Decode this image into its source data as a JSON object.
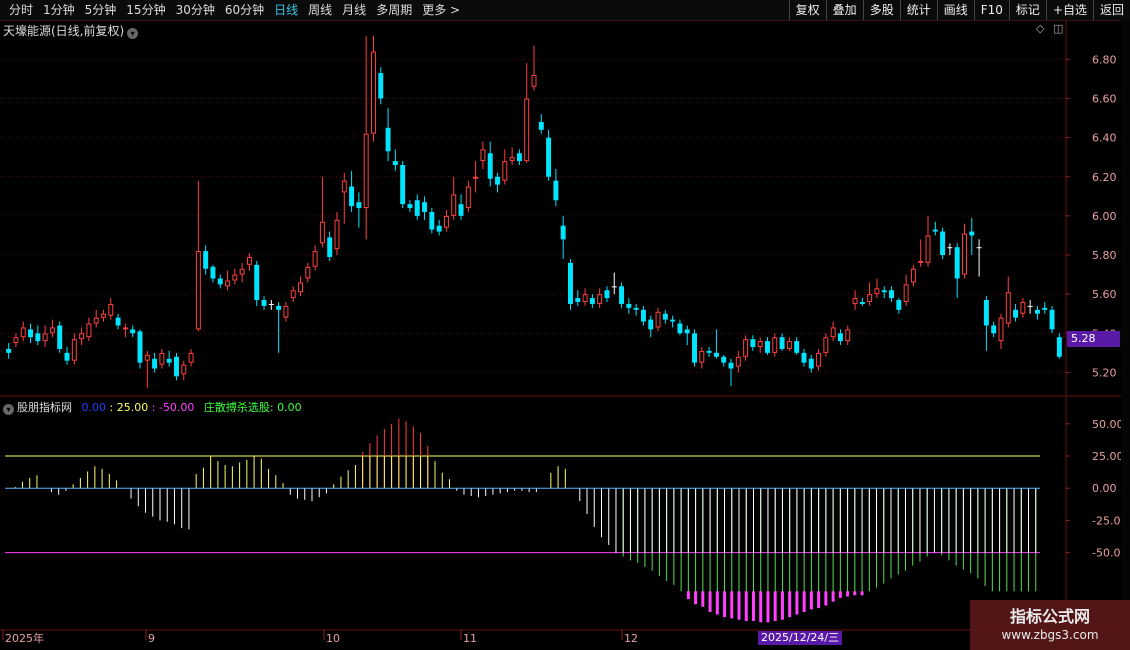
{
  "toolbar": {
    "periods": [
      "分时",
      "1分钟",
      "5分钟",
      "15分钟",
      "30分钟",
      "60分钟",
      "日线",
      "周线",
      "月线",
      "多周期",
      "更多 >"
    ],
    "active_period": "日线",
    "actions": [
      "复权",
      "叠加",
      "多股",
      "统计",
      "画线",
      "F10",
      "标记",
      "+自选",
      "返回"
    ]
  },
  "chart": {
    "title": "天壕能源(日线,前复权)",
    "price_ticks": [
      "6.80",
      "6.60",
      "6.40",
      "6.20",
      "6.00",
      "5.80",
      "5.60",
      "5.40",
      "5.20"
    ],
    "price_ticks_values": [
      6.8,
      6.6,
      6.4,
      6.2,
      6.0,
      5.8,
      5.6,
      5.4,
      5.2
    ],
    "current_price": "5.28",
    "colors": {
      "up": "#ff4040",
      "down": "#00e5ff",
      "flat": "#ffffff"
    }
  },
  "indicator": {
    "name": "股朋指标网",
    "line0": "0.00",
    "line25": "25.00",
    "line_neg50": "-50.00",
    "select_label": "庄散搏杀选股: 0.00",
    "axis_ticks": [
      "50.00",
      "25.00",
      "0.00",
      "-25.00",
      "-50.00"
    ],
    "axis_values": [
      50,
      25,
      0,
      -25,
      -50
    ]
  },
  "xaxis": {
    "labels": [
      "2025年",
      "9",
      "10",
      "11",
      "12"
    ],
    "cursor_date": "2025/12/24/三"
  },
  "watermark": {
    "line1": "指标公式网",
    "line2": "www.zbgs3.com"
  },
  "icons": [
    "chevron-down-icon",
    "diamond-icon",
    "window-restore-icon"
  ],
  "chart_data": {
    "type": "candlestick",
    "title": "天壕能源(日线,前复权)",
    "ylim": [
      5.1,
      6.95
    ],
    "candles": [
      [
        5.32,
        5.3,
        5.35,
        5.27
      ],
      [
        5.35,
        5.38,
        5.4,
        5.33
      ],
      [
        5.38,
        5.43,
        5.46,
        5.36
      ],
      [
        5.42,
        5.38,
        5.45,
        5.35
      ],
      [
        5.4,
        5.36,
        5.44,
        5.34
      ],
      [
        5.36,
        5.4,
        5.44,
        5.33
      ],
      [
        5.4,
        5.43,
        5.47,
        5.38
      ],
      [
        5.44,
        5.32,
        5.46,
        5.3
      ],
      [
        5.3,
        5.26,
        5.33,
        5.24
      ],
      [
        5.26,
        5.37,
        5.4,
        5.24
      ],
      [
        5.37,
        5.4,
        5.43,
        5.34
      ],
      [
        5.38,
        5.45,
        5.48,
        5.36
      ],
      [
        5.45,
        5.48,
        5.52,
        5.43
      ],
      [
        5.48,
        5.5,
        5.52,
        5.46
      ],
      [
        5.49,
        5.55,
        5.58,
        5.47
      ],
      [
        5.48,
        5.44,
        5.5,
        5.42
      ],
      [
        5.42,
        5.43,
        5.45,
        5.38
      ],
      [
        5.42,
        5.4,
        5.44,
        5.38
      ],
      [
        5.41,
        5.25,
        5.42,
        5.22
      ],
      [
        5.26,
        5.29,
        5.31,
        5.12
      ],
      [
        5.27,
        5.22,
        5.3,
        5.2
      ],
      [
        5.24,
        5.3,
        5.32,
        5.22
      ],
      [
        5.27,
        5.25,
        5.31,
        5.23
      ],
      [
        5.28,
        5.18,
        5.3,
        5.16
      ],
      [
        5.19,
        5.24,
        5.26,
        5.16
      ],
      [
        5.25,
        5.3,
        5.32,
        5.23
      ],
      [
        5.42,
        5.82,
        6.18,
        5.41
      ],
      [
        5.82,
        5.73,
        5.85,
        5.7
      ],
      [
        5.74,
        5.68,
        5.75,
        5.66
      ],
      [
        5.68,
        5.65,
        5.7,
        5.63
      ],
      [
        5.64,
        5.67,
        5.72,
        5.62
      ],
      [
        5.67,
        5.7,
        5.73,
        5.65
      ],
      [
        5.7,
        5.73,
        5.76,
        5.66
      ],
      [
        5.75,
        5.79,
        5.81,
        5.72
      ],
      [
        5.75,
        5.57,
        5.77,
        5.54
      ],
      [
        5.57,
        5.54,
        5.59,
        5.52
      ],
      [
        5.55,
        5.55,
        5.57,
        5.52
      ],
      [
        5.54,
        5.52,
        5.56,
        5.3
      ],
      [
        5.48,
        5.54,
        5.56,
        5.46
      ],
      [
        5.58,
        5.62,
        5.64,
        5.56
      ],
      [
        5.61,
        5.66,
        5.69,
        5.59
      ],
      [
        5.68,
        5.74,
        5.76,
        5.66
      ],
      [
        5.74,
        5.82,
        5.85,
        5.72
      ],
      [
        5.86,
        5.97,
        6.2,
        5.84
      ],
      [
        5.89,
        5.79,
        5.92,
        5.77
      ],
      [
        5.83,
        5.98,
        6.02,
        5.8
      ],
      [
        6.12,
        6.18,
        6.22,
        5.96
      ],
      [
        6.15,
        6.05,
        6.23,
        6.02
      ],
      [
        6.07,
        6.04,
        6.12,
        5.94
      ],
      [
        6.04,
        6.42,
        6.92,
        5.88
      ],
      [
        6.42,
        6.84,
        6.92,
        6.38
      ],
      [
        6.73,
        6.6,
        6.76,
        6.57
      ],
      [
        6.45,
        6.33,
        6.55,
        6.28
      ],
      [
        6.28,
        6.26,
        6.34,
        6.23
      ],
      [
        6.26,
        6.06,
        6.28,
        6.04
      ],
      [
        6.06,
        6.04,
        6.08,
        6.02
      ],
      [
        6.08,
        6.0,
        6.11,
        5.98
      ],
      [
        6.07,
        6.02,
        6.1,
        5.98
      ],
      [
        6.02,
        5.93,
        6.04,
        5.91
      ],
      [
        5.95,
        5.92,
        5.98,
        5.9
      ],
      [
        5.94,
        6.0,
        6.03,
        5.92
      ],
      [
        6.0,
        6.11,
        6.2,
        5.98
      ],
      [
        6.06,
        6.0,
        6.11,
        5.98
      ],
      [
        6.04,
        6.15,
        6.18,
        6.02
      ],
      [
        6.19,
        6.2,
        6.28,
        6.12
      ],
      [
        6.28,
        6.34,
        6.38,
        6.24
      ],
      [
        6.32,
        6.19,
        6.38,
        6.15
      ],
      [
        6.2,
        6.16,
        6.22,
        6.12
      ],
      [
        6.18,
        6.28,
        6.34,
        6.16
      ],
      [
        6.28,
        6.3,
        6.35,
        6.26
      ],
      [
        6.32,
        6.28,
        6.34,
        6.26
      ],
      [
        6.28,
        6.6,
        6.78,
        6.27
      ],
      [
        6.66,
        6.72,
        6.87,
        6.64
      ],
      [
        6.48,
        6.44,
        6.52,
        6.42
      ],
      [
        6.4,
        6.2,
        6.44,
        6.18
      ],
      [
        6.18,
        6.08,
        6.24,
        6.05
      ],
      [
        5.95,
        5.88,
        6.0,
        5.78
      ],
      [
        5.76,
        5.55,
        5.78,
        5.52
      ],
      [
        5.58,
        5.56,
        5.62,
        5.54
      ],
      [
        5.56,
        5.6,
        5.63,
        5.54
      ],
      [
        5.58,
        5.55,
        5.6,
        5.53
      ],
      [
        5.55,
        5.6,
        5.63,
        5.53
      ],
      [
        5.62,
        5.58,
        5.64,
        5.56
      ],
      [
        5.64,
        5.64,
        5.71,
        5.6
      ],
      [
        5.64,
        5.55,
        5.66,
        5.53
      ],
      [
        5.55,
        5.53,
        5.58,
        5.5
      ],
      [
        5.53,
        5.52,
        5.55,
        5.49
      ],
      [
        5.52,
        5.46,
        5.54,
        5.44
      ],
      [
        5.47,
        5.42,
        5.49,
        5.38
      ],
      [
        5.43,
        5.51,
        5.53,
        5.41
      ],
      [
        5.5,
        5.47,
        5.52,
        5.45
      ],
      [
        5.47,
        5.46,
        5.49,
        5.43
      ],
      [
        5.45,
        5.4,
        5.47,
        5.39
      ],
      [
        5.42,
        5.4,
        5.44,
        5.34
      ],
      [
        5.4,
        5.25,
        5.42,
        5.23
      ],
      [
        5.25,
        5.31,
        5.33,
        5.22
      ],
      [
        5.31,
        5.3,
        5.33,
        5.28
      ],
      [
        5.3,
        5.28,
        5.42,
        5.27
      ],
      [
        5.28,
        5.25,
        5.29,
        5.23
      ],
      [
        5.25,
        5.22,
        5.27,
        5.13
      ],
      [
        5.23,
        5.28,
        5.31,
        5.2
      ],
      [
        5.28,
        5.37,
        5.39,
        5.26
      ],
      [
        5.37,
        5.33,
        5.39,
        5.31
      ],
      [
        5.33,
        5.36,
        5.38,
        5.3
      ],
      [
        5.36,
        5.3,
        5.38,
        5.29
      ],
      [
        5.3,
        5.38,
        5.4,
        5.28
      ],
      [
        5.38,
        5.32,
        5.4,
        5.31
      ],
      [
        5.32,
        5.36,
        5.38,
        5.31
      ],
      [
        5.36,
        5.3,
        5.38,
        5.29
      ],
      [
        5.3,
        5.25,
        5.32,
        5.23
      ],
      [
        5.27,
        5.22,
        5.29,
        5.2
      ],
      [
        5.23,
        5.3,
        5.32,
        5.21
      ],
      [
        5.3,
        5.38,
        5.4,
        5.28
      ],
      [
        5.38,
        5.43,
        5.46,
        5.36
      ],
      [
        5.4,
        5.36,
        5.42,
        5.34
      ],
      [
        5.36,
        5.42,
        5.44,
        5.34
      ],
      [
        5.55,
        5.58,
        5.62,
        5.52
      ],
      [
        5.56,
        5.55,
        5.58,
        5.54
      ],
      [
        5.56,
        5.6,
        5.66,
        5.54
      ],
      [
        5.6,
        5.63,
        5.68,
        5.58
      ],
      [
        5.62,
        5.61,
        5.64,
        5.58
      ],
      [
        5.62,
        5.58,
        5.64,
        5.56
      ],
      [
        5.57,
        5.52,
        5.58,
        5.5
      ],
      [
        5.56,
        5.65,
        5.7,
        5.54
      ],
      [
        5.66,
        5.73,
        5.75,
        5.64
      ],
      [
        5.76,
        5.77,
        5.88,
        5.74
      ],
      [
        5.76,
        5.9,
        6.0,
        5.74
      ],
      [
        5.93,
        5.92,
        5.97,
        5.9
      ],
      [
        5.92,
        5.8,
        5.94,
        5.78
      ],
      [
        5.84,
        5.84,
        5.86,
        5.8
      ],
      [
        5.84,
        5.68,
        5.86,
        5.58
      ],
      [
        5.7,
        5.91,
        5.96,
        5.68
      ],
      [
        5.92,
        5.9,
        5.99,
        5.8
      ],
      [
        5.84,
        5.84,
        5.88,
        5.69
      ],
      [
        5.57,
        5.44,
        5.59,
        5.31
      ],
      [
        5.44,
        5.4,
        5.46,
        5.38
      ],
      [
        5.36,
        5.48,
        5.5,
        5.32
      ],
      [
        5.45,
        5.61,
        5.69,
        5.43
      ],
      [
        5.52,
        5.48,
        5.55,
        5.46
      ],
      [
        5.5,
        5.56,
        5.58,
        5.48
      ],
      [
        5.54,
        5.54,
        5.57,
        5.5
      ],
      [
        5.52,
        5.5,
        5.54,
        5.47
      ],
      [
        5.53,
        5.52,
        5.56,
        5.5
      ],
      [
        5.52,
        5.42,
        5.54,
        5.4
      ],
      [
        5.38,
        5.28,
        5.4,
        5.27
      ]
    ],
    "indicator_bars": [
      0,
      1,
      5,
      8,
      10,
      0,
      -3,
      -5,
      -2,
      3,
      8,
      13,
      17,
      15,
      11,
      6,
      0,
      -8,
      -14,
      -19,
      -22,
      -25,
      -26,
      -28,
      -31,
      -32,
      11,
      16,
      25,
      21,
      18,
      17,
      20,
      22,
      25,
      23,
      15,
      10,
      4,
      -5,
      -8,
      -9,
      -10,
      -7,
      -4,
      3,
      9,
      14,
      18,
      28,
      35,
      41,
      46,
      50,
      54,
      52,
      48,
      43,
      33,
      21,
      12,
      7,
      -2,
      -5,
      -6,
      -7,
      -6,
      -5,
      -4,
      -3,
      -2,
      -2,
      -3,
      -3,
      0,
      12,
      17,
      15,
      0,
      -10,
      -20,
      -30,
      -38,
      -44,
      -50,
      -53,
      -56,
      -58,
      -61,
      -64,
      -68,
      -72,
      -75,
      -80,
      -86,
      -90,
      -92,
      -96,
      -98,
      -100,
      -101,
      -102,
      -103,
      -103,
      -104,
      -104,
      -103,
      -102,
      -100,
      -98,
      -96,
      -94,
      -93,
      -91,
      -88,
      -85,
      -84,
      -83,
      -83,
      -80,
      -77,
      -74,
      -70,
      -67,
      -64,
      -60,
      -57,
      -53,
      -50,
      -52,
      -56,
      -60,
      -63,
      -66,
      -70,
      -76,
      -80,
      -80,
      -80,
      -80,
      -80,
      -80,
      -80
    ]
  }
}
